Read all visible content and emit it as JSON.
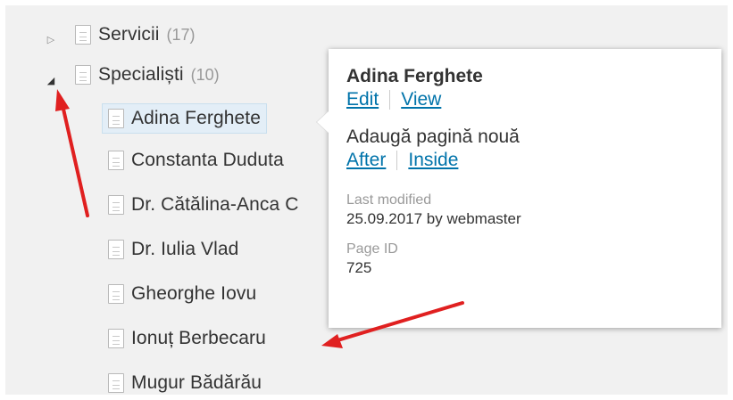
{
  "tree": {
    "items": [
      {
        "label": "Servicii",
        "count": "(17)",
        "toggle": "▷"
      },
      {
        "label": "Specialiști",
        "count": "(10)",
        "toggle": "◢"
      }
    ],
    "children": [
      {
        "label": "Adina Ferghete"
      },
      {
        "label": "Constanta Duduta"
      },
      {
        "label": "Dr. Cătălina-Anca C"
      },
      {
        "label": "Dr. Iulia Vlad"
      },
      {
        "label": "Gheorghe Iovu"
      },
      {
        "label": "Ionuț Berbecaru"
      },
      {
        "label": "Mugur Bădărău"
      }
    ]
  },
  "popover": {
    "title": "Adina Ferghete",
    "edit_label": "Edit",
    "view_label": "View",
    "add_page_text": "Adaugă pagină nouă",
    "after_label": "After",
    "inside_label": "Inside",
    "last_modified_label": "Last modified",
    "last_modified_value": "25.09.2017 by webmaster",
    "page_id_label": "Page ID",
    "page_id_value": "725"
  },
  "colors": {
    "link": "#0073aa",
    "selected_bg": "#e3eef7",
    "annotation_arrow": "#e02020",
    "panel_bg": "#f1f1f1"
  }
}
